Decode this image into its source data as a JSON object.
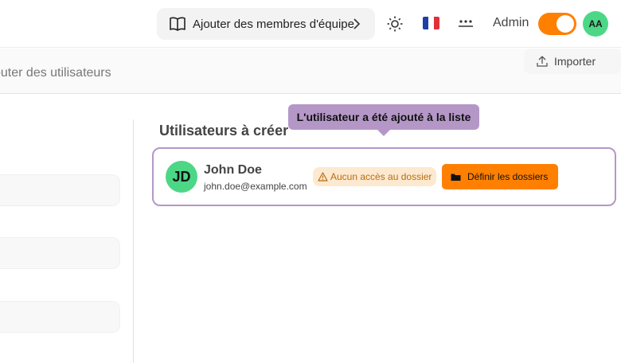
{
  "header": {
    "team_button_label": "Ajouter des membres d'équipe",
    "admin_label": "Admin",
    "avatar_initials": "AA",
    "toggle_on": true,
    "icons": {
      "book": "book-icon",
      "chevron": "chevron-right-icon",
      "theme": "sun-icon",
      "language": "flag-fr-icon",
      "password": "password-icon"
    }
  },
  "subheader": {
    "title": "outer des utilisateurs",
    "import_label": "Importer"
  },
  "main": {
    "section_title": "Utilisateurs à créer",
    "tooltip": "L'utilisateur a été ajouté à la liste",
    "user": {
      "initials": "JD",
      "name": "John Doe",
      "email": "john.doe@example.com",
      "badge": "Aucun accès au dossier",
      "folders_button": "Définir les dossiers"
    }
  },
  "colors": {
    "accent": "#ff8000",
    "avatar": "#4cd787",
    "highlight": "#b497c7",
    "warning_bg": "#fde9cf",
    "warning_text": "#b66d12"
  }
}
